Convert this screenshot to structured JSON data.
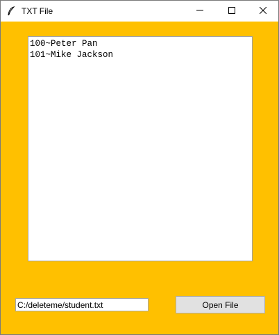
{
  "window": {
    "title": "TXT File",
    "background_color": "#ffc000"
  },
  "titlebar": {
    "app_icon": "feather-icon",
    "minimize_icon": "minimize-icon",
    "maximize_icon": "maximize-icon",
    "close_icon": "close-icon"
  },
  "content": {
    "lines": [
      "100~Peter Pan",
      "101~Mike Jackson"
    ]
  },
  "footer": {
    "path_value": "C:/deleteme/student.txt",
    "open_button_label": "Open File"
  }
}
